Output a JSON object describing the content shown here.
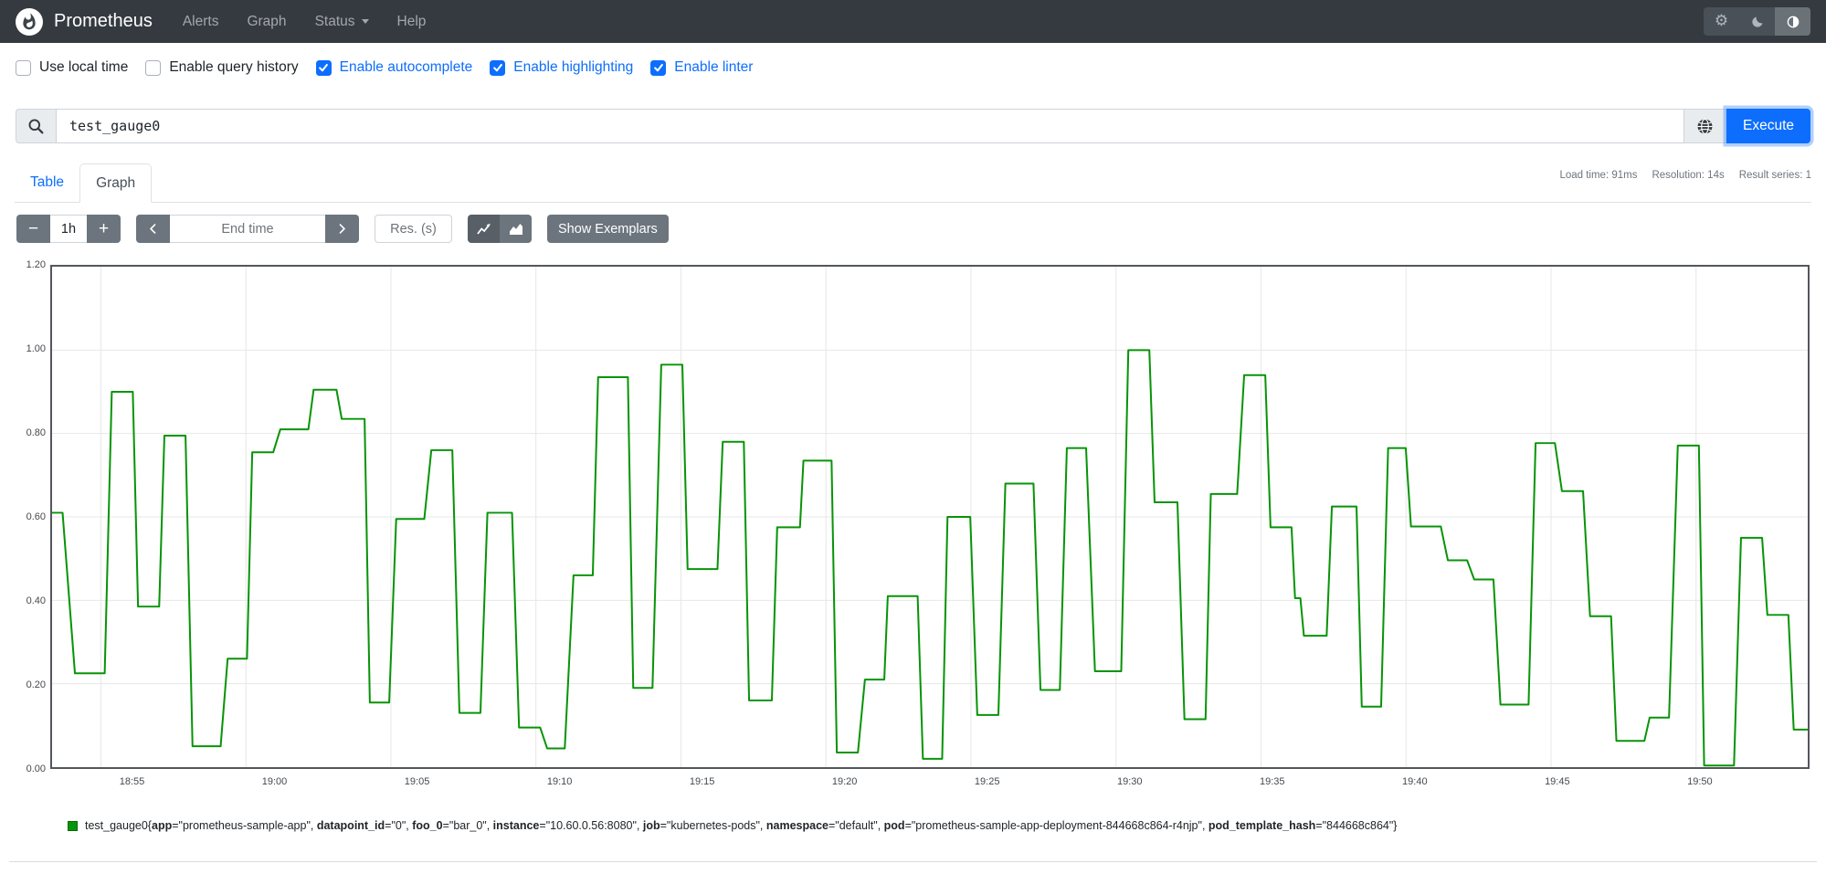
{
  "colors": {
    "navbar_bg": "#343a40",
    "accent_blue": "#0d6efd",
    "button_gray": "#6c757d",
    "series_green": "#089408"
  },
  "navbar": {
    "brand": "Prometheus",
    "items": [
      {
        "label": "Alerts"
      },
      {
        "label": "Graph"
      },
      {
        "label": "Status"
      },
      {
        "label": "Help"
      }
    ]
  },
  "options": {
    "items": [
      {
        "label": "Use local time",
        "checked": false
      },
      {
        "label": "Enable query history",
        "checked": false
      },
      {
        "label": "Enable autocomplete",
        "checked": true
      },
      {
        "label": "Enable highlighting",
        "checked": true
      },
      {
        "label": "Enable linter",
        "checked": true
      }
    ]
  },
  "query": {
    "value": "test_gauge0",
    "execute_label": "Execute"
  },
  "stats": {
    "items": [
      "Load time: 91ms",
      "Resolution: 14s",
      "Result series: 1"
    ]
  },
  "tabs": {
    "items": [
      {
        "label": "Table",
        "active": false
      },
      {
        "label": "Graph",
        "active": true
      }
    ]
  },
  "controls": {
    "minus_label": "−",
    "duration": "1h",
    "plus_label": "+",
    "end_time_placeholder": "End time",
    "resolution_placeholder": "Res. (s)",
    "show_exemplars_label": "Show Exemplars"
  },
  "legend": {
    "metric": "test_gauge0",
    "labels": [
      {
        "key": "app",
        "value": "prometheus-sample-app"
      },
      {
        "key": "datapoint_id",
        "value": "0"
      },
      {
        "key": "foo_0",
        "value": "bar_0"
      },
      {
        "key": "instance",
        "value": "10.60.0.56:8080"
      },
      {
        "key": "job",
        "value": "kubernetes-pods"
      },
      {
        "key": "namespace",
        "value": "default"
      },
      {
        "key": "pod",
        "value": "prometheus-sample-app-deployment-844668c864-r4njp"
      },
      {
        "key": "pod_template_hash",
        "value": "844668c864"
      }
    ]
  },
  "chart_data": {
    "type": "line",
    "title": "",
    "xlabel": "",
    "ylabel": "",
    "ylim": [
      0,
      1.2
    ],
    "grid": true,
    "legend_position": "bottom",
    "y_ticks": [
      {
        "value": 0.0,
        "label": "0.00"
      },
      {
        "value": 0.2,
        "label": "0.20"
      },
      {
        "value": 0.4,
        "label": "0.40"
      },
      {
        "value": 0.6,
        "label": "0.60"
      },
      {
        "value": 0.8,
        "label": "0.80"
      },
      {
        "value": 1.0,
        "label": "1.00"
      },
      {
        "value": 1.2,
        "label": "1.20"
      }
    ],
    "x_ticks": [
      {
        "f": 0.0278,
        "label": "18:55"
      },
      {
        "f": 0.1104,
        "label": "19:00"
      },
      {
        "f": 0.193,
        "label": "19:05"
      },
      {
        "f": 0.2756,
        "label": "19:10"
      },
      {
        "f": 0.3582,
        "label": "19:15"
      },
      {
        "f": 0.4408,
        "label": "19:20"
      },
      {
        "f": 0.5234,
        "label": "19:25"
      },
      {
        "f": 0.606,
        "label": "19:30"
      },
      {
        "f": 0.6886,
        "label": "19:35"
      },
      {
        "f": 0.7712,
        "label": "19:40"
      },
      {
        "f": 0.8538,
        "label": "19:45"
      },
      {
        "f": 0.9364,
        "label": "19:50"
      }
    ],
    "series": [
      {
        "name": "test_gauge0{app=\"prometheus-sample-app\", datapoint_id=\"0\", foo_0=\"bar_0\", instance=\"10.60.0.56:8080\", job=\"kubernetes-pods\", namespace=\"default\", pod=\"prometheus-sample-app-deployment-844668c864-r4njp\", pod_template_hash=\"844668c864\"}",
        "color": "#089408",
        "points": [
          [
            0.0,
            0.61
          ],
          [
            0.006,
            0.61
          ],
          [
            0.013,
            0.225
          ],
          [
            0.03,
            0.225
          ],
          [
            0.034,
            0.9
          ],
          [
            0.046,
            0.9
          ],
          [
            0.049,
            0.385
          ],
          [
            0.061,
            0.385
          ],
          [
            0.064,
            0.795
          ],
          [
            0.076,
            0.795
          ],
          [
            0.08,
            0.05
          ],
          [
            0.096,
            0.05
          ],
          [
            0.1,
            0.26
          ],
          [
            0.111,
            0.26
          ],
          [
            0.114,
            0.755
          ],
          [
            0.126,
            0.755
          ],
          [
            0.13,
            0.81
          ],
          [
            0.146,
            0.81
          ],
          [
            0.149,
            0.905
          ],
          [
            0.162,
            0.905
          ],
          [
            0.165,
            0.835
          ],
          [
            0.178,
            0.835
          ],
          [
            0.181,
            0.155
          ],
          [
            0.192,
            0.155
          ],
          [
            0.196,
            0.595
          ],
          [
            0.212,
            0.595
          ],
          [
            0.216,
            0.76
          ],
          [
            0.228,
            0.76
          ],
          [
            0.232,
            0.13
          ],
          [
            0.244,
            0.13
          ],
          [
            0.248,
            0.61
          ],
          [
            0.262,
            0.61
          ],
          [
            0.266,
            0.095
          ],
          [
            0.278,
            0.095
          ],
          [
            0.282,
            0.045
          ],
          [
            0.292,
            0.045
          ],
          [
            0.297,
            0.46
          ],
          [
            0.308,
            0.46
          ],
          [
            0.311,
            0.935
          ],
          [
            0.328,
            0.935
          ],
          [
            0.331,
            0.19
          ],
          [
            0.342,
            0.19
          ],
          [
            0.347,
            0.965
          ],
          [
            0.359,
            0.965
          ],
          [
            0.362,
            0.475
          ],
          [
            0.379,
            0.475
          ],
          [
            0.382,
            0.78
          ],
          [
            0.394,
            0.78
          ],
          [
            0.397,
            0.16
          ],
          [
            0.41,
            0.16
          ],
          [
            0.413,
            0.575
          ],
          [
            0.426,
            0.575
          ],
          [
            0.428,
            0.735
          ],
          [
            0.444,
            0.735
          ],
          [
            0.447,
            0.035
          ],
          [
            0.459,
            0.035
          ],
          [
            0.463,
            0.21
          ],
          [
            0.474,
            0.21
          ],
          [
            0.476,
            0.41
          ],
          [
            0.493,
            0.41
          ],
          [
            0.496,
            0.02
          ],
          [
            0.507,
            0.02
          ],
          [
            0.51,
            0.6
          ],
          [
            0.523,
            0.6
          ],
          [
            0.527,
            0.125
          ],
          [
            0.539,
            0.125
          ],
          [
            0.543,
            0.68
          ],
          [
            0.559,
            0.68
          ],
          [
            0.563,
            0.185
          ],
          [
            0.574,
            0.185
          ],
          [
            0.578,
            0.765
          ],
          [
            0.589,
            0.765
          ],
          [
            0.594,
            0.23
          ],
          [
            0.609,
            0.23
          ],
          [
            0.613,
            1.0
          ],
          [
            0.625,
            1.0
          ],
          [
            0.628,
            0.635
          ],
          [
            0.641,
            0.635
          ],
          [
            0.645,
            0.115
          ],
          [
            0.657,
            0.115
          ],
          [
            0.66,
            0.655
          ],
          [
            0.675,
            0.655
          ],
          [
            0.679,
            0.94
          ],
          [
            0.691,
            0.94
          ],
          [
            0.694,
            0.575
          ],
          [
            0.706,
            0.575
          ],
          [
            0.708,
            0.405
          ],
          [
            0.711,
            0.405
          ],
          [
            0.713,
            0.315
          ],
          [
            0.726,
            0.315
          ],
          [
            0.729,
            0.625
          ],
          [
            0.743,
            0.625
          ],
          [
            0.746,
            0.145
          ],
          [
            0.757,
            0.145
          ],
          [
            0.761,
            0.765
          ],
          [
            0.771,
            0.765
          ],
          [
            0.774,
            0.577
          ],
          [
            0.791,
            0.577
          ],
          [
            0.795,
            0.496
          ],
          [
            0.806,
            0.496
          ],
          [
            0.81,
            0.45
          ],
          [
            0.821,
            0.45
          ],
          [
            0.825,
            0.15
          ],
          [
            0.841,
            0.15
          ],
          [
            0.845,
            0.777
          ],
          [
            0.856,
            0.777
          ],
          [
            0.86,
            0.662
          ],
          [
            0.872,
            0.662
          ],
          [
            0.876,
            0.362
          ],
          [
            0.888,
            0.362
          ],
          [
            0.891,
            0.063
          ],
          [
            0.907,
            0.063
          ],
          [
            0.91,
            0.119
          ],
          [
            0.921,
            0.119
          ],
          [
            0.926,
            0.771
          ],
          [
            0.938,
            0.771
          ],
          [
            0.941,
            0.004
          ],
          [
            0.958,
            0.004
          ],
          [
            0.962,
            0.55
          ],
          [
            0.974,
            0.55
          ],
          [
            0.977,
            0.365
          ],
          [
            0.989,
            0.365
          ],
          [
            0.992,
            0.09
          ],
          [
            1.0,
            0.09
          ]
        ]
      }
    ]
  }
}
